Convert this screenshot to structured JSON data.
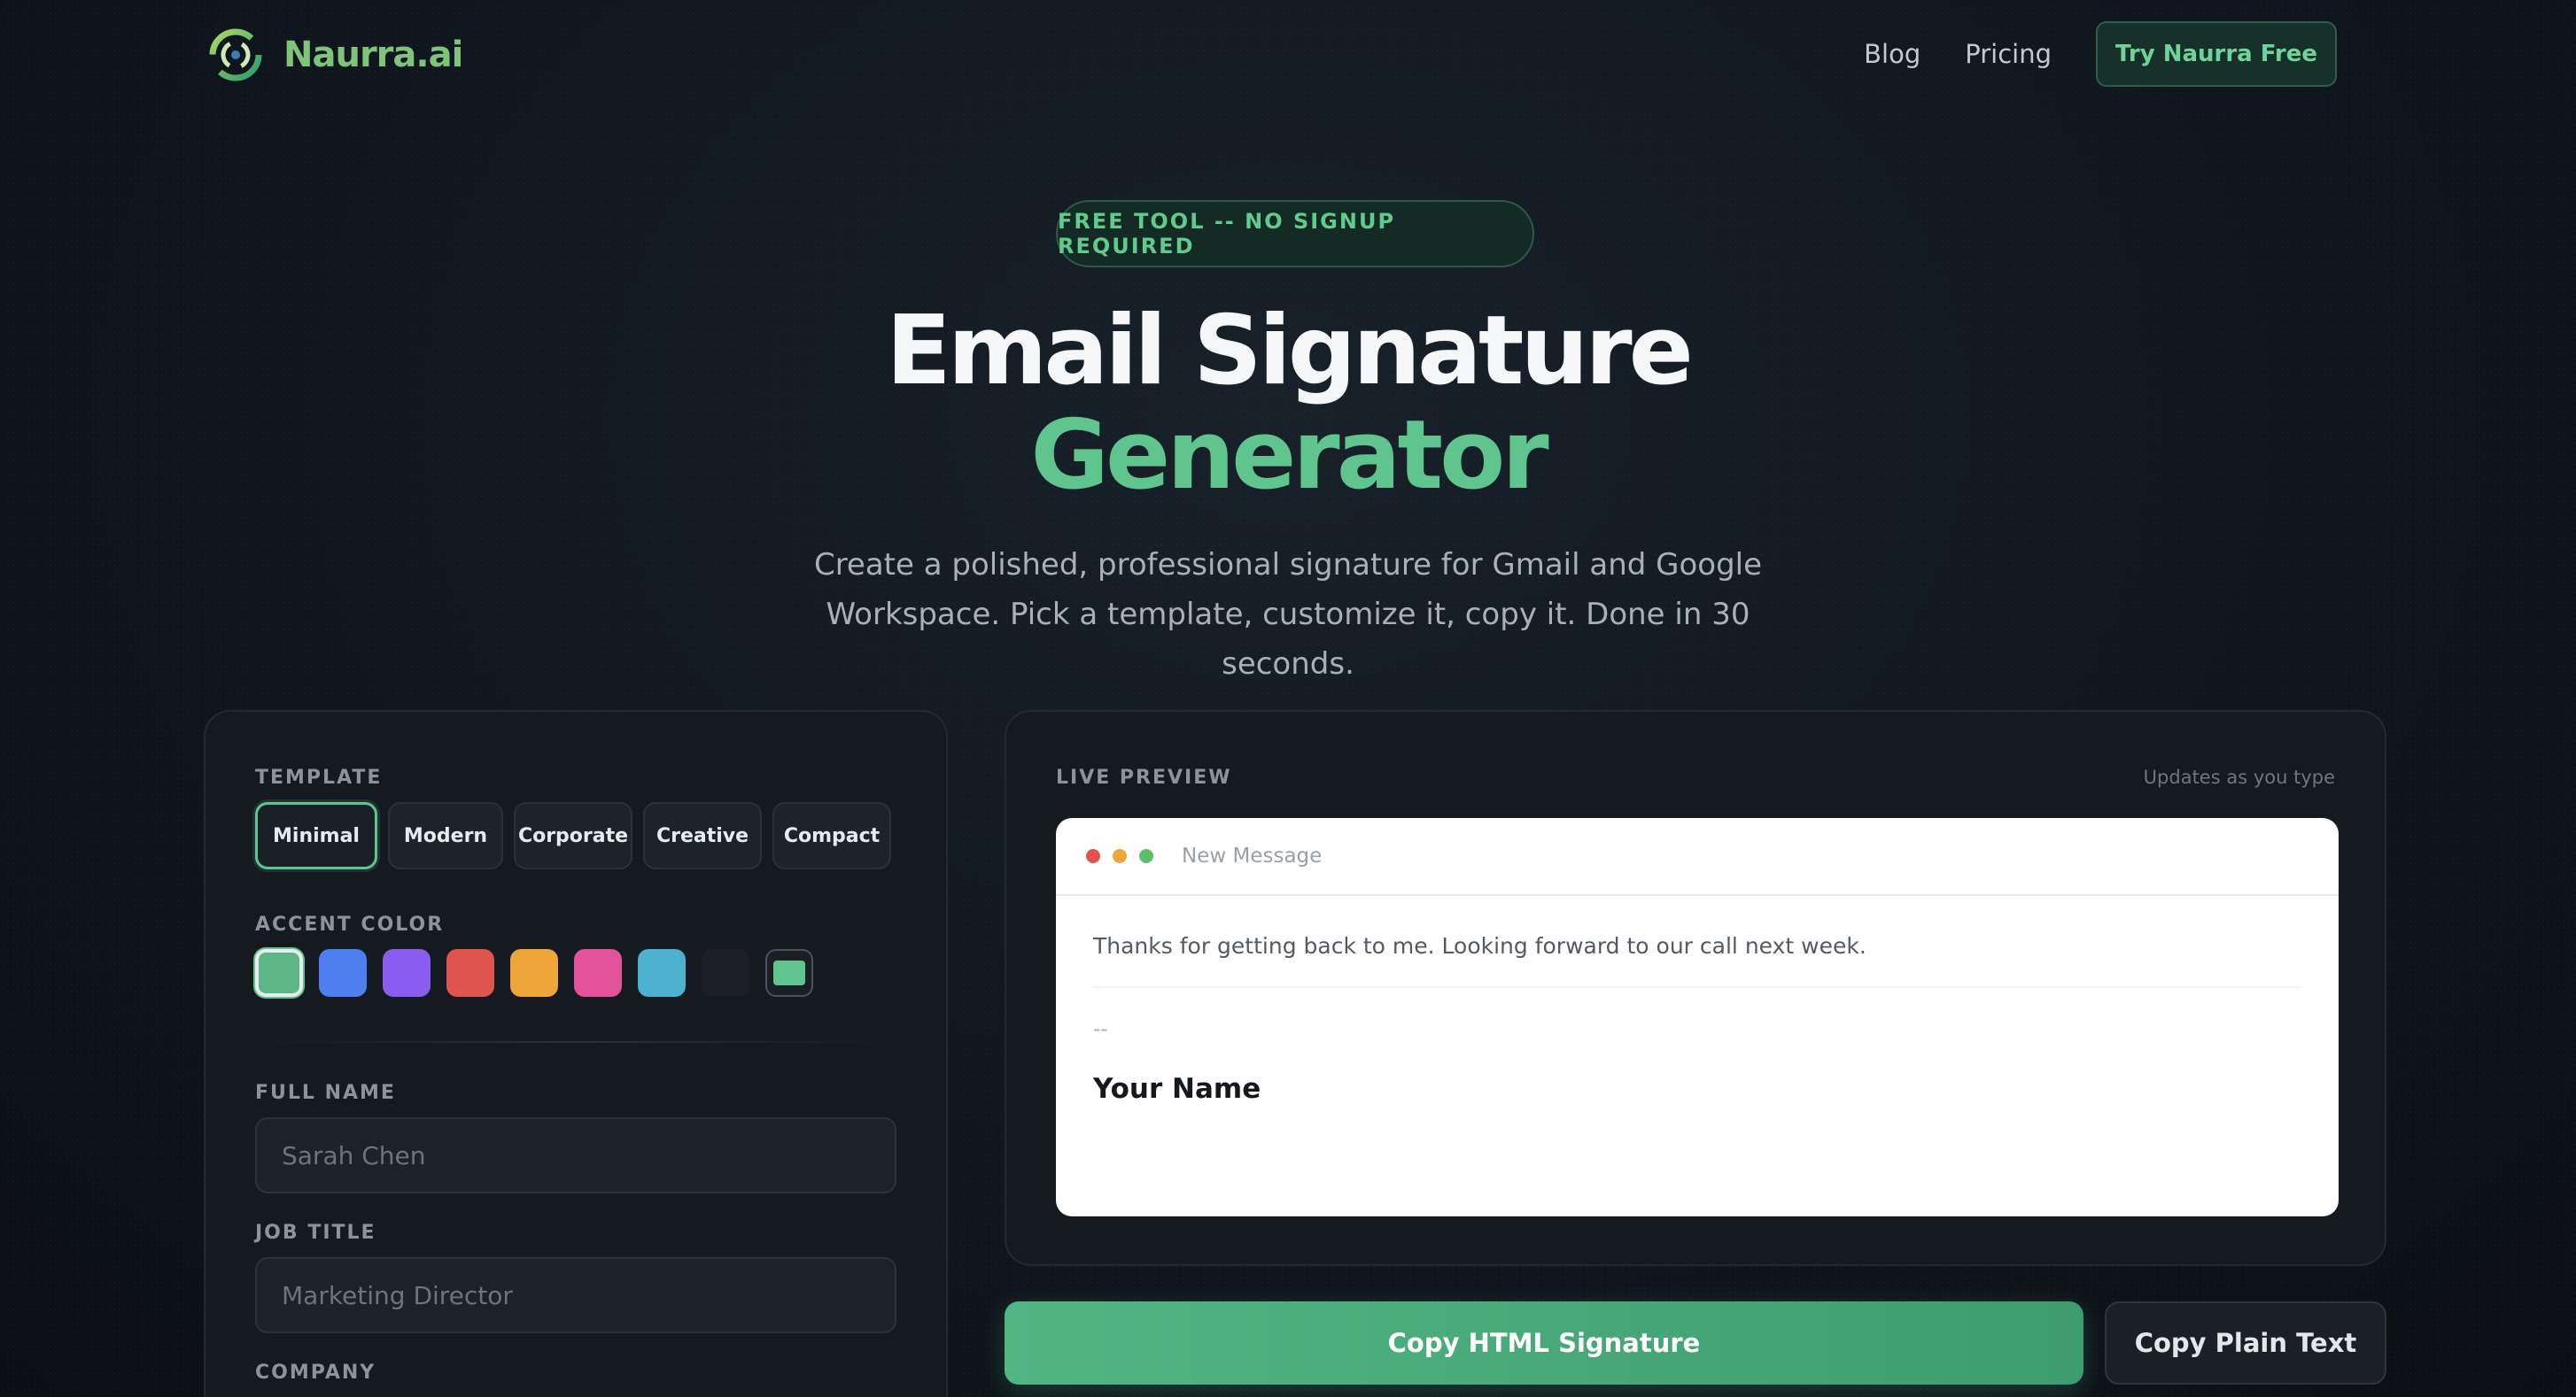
{
  "brand": {
    "name": "Naurra.ai",
    "accent": "#5fc48d"
  },
  "nav": {
    "links": [
      {
        "label": "Blog"
      },
      {
        "label": "Pricing"
      }
    ],
    "cta_label": "Try Naurra Free"
  },
  "hero": {
    "badge": "FREE TOOL -- NO SIGNUP REQUIRED",
    "title_line1": "Email Signature",
    "title_line2": "Generator",
    "subtitle": "Create a polished, professional signature for Gmail and Google Workspace. Pick a template, customize it, copy it. Done in 30 seconds."
  },
  "form": {
    "template_label": "TEMPLATE",
    "templates": [
      {
        "label": "Minimal",
        "active": true
      },
      {
        "label": "Modern",
        "active": false
      },
      {
        "label": "Corporate",
        "active": false
      },
      {
        "label": "Creative",
        "active": false
      },
      {
        "label": "Compact",
        "active": false
      }
    ],
    "accent_label": "ACCENT COLOR",
    "accent_colors": [
      "#5cb685",
      "#4f7ef0",
      "#8b5cf0",
      "#e0544f",
      "#eea63a",
      "#e3539c",
      "#4db2ce",
      "#1c1f23"
    ],
    "full_name_label": "FULL NAME",
    "full_name_placeholder": "Sarah Chen",
    "job_title_label": "JOB TITLE",
    "job_title_placeholder": "Marketing Director",
    "company_label": "COMPANY"
  },
  "preview": {
    "label": "LIVE PREVIEW",
    "updates_note": "Updates as you type",
    "window_title": "New Message",
    "message_body": "Thanks for getting back to me. Looking forward to our call next week.",
    "sig_separator": "--",
    "sig_name": "Your Name"
  },
  "actions": {
    "copy_html": "Copy HTML Signature",
    "copy_plain": "Copy Plain Text"
  }
}
